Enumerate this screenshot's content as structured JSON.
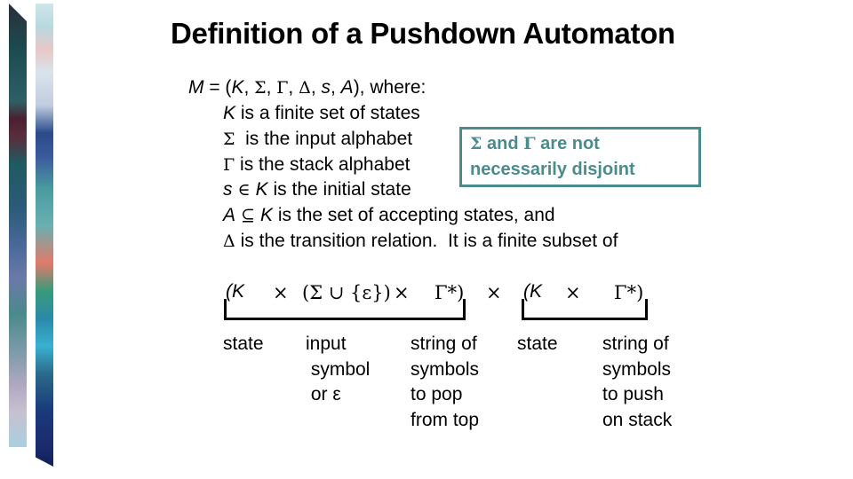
{
  "title": "Definition of a Pushdown Automaton",
  "definition": {
    "tuple_line": {
      "M": "M",
      "eq": " = (",
      "K": "K",
      "sep1": ", ",
      "Sigma": "Σ",
      "sep2": ", ",
      "Gamma": "Γ",
      "sep3": ", ",
      "Delta": "Δ",
      "sep4": ", ",
      "s": "s",
      "sep5": ", ",
      "A": "A",
      "tail": "), where:"
    },
    "items": [
      {
        "symbol": "K",
        "text": " is a finite set of states"
      },
      {
        "symbol": "Σ",
        "text": "  is the input alphabet"
      },
      {
        "symbol": "Γ",
        "text": " is the stack alphabet"
      },
      {
        "symbol": "s",
        "op": " ∈ ",
        "symbol2": "K",
        "text": " is the initial state"
      },
      {
        "symbol": "A",
        "op": " ⊆ ",
        "symbol2": "K",
        "text": " is the set of accepting states, and"
      },
      {
        "symbol": "Δ",
        "text": " is the transition relation.  It is a finite subset of"
      }
    ]
  },
  "note": {
    "line1": {
      "sigma": "Σ",
      "mid": " and ",
      "gamma": "Γ",
      "tail": " are not"
    },
    "line2": "necessarily disjoint",
    "color": "#4a8c8e"
  },
  "expression": {
    "open_K": "(K",
    "times1": "×",
    "sigma_eps": "(Σ ∪ {ε})",
    "times2": "×",
    "gamma_star1": "Γ*)",
    "times3": "×",
    "open_K2": "(K",
    "times4": "×",
    "gamma_star2": "Γ*)"
  },
  "labels": [
    {
      "lines": [
        "state"
      ]
    },
    {
      "lines": [
        "input",
        " symbol",
        " or ε"
      ]
    },
    {
      "lines": [
        "string of",
        "symbols",
        "to pop",
        "from top"
      ]
    },
    {
      "lines": [
        "state"
      ]
    },
    {
      "lines": [
        "string of",
        "symbols",
        "to push",
        "on stack"
      ]
    }
  ]
}
